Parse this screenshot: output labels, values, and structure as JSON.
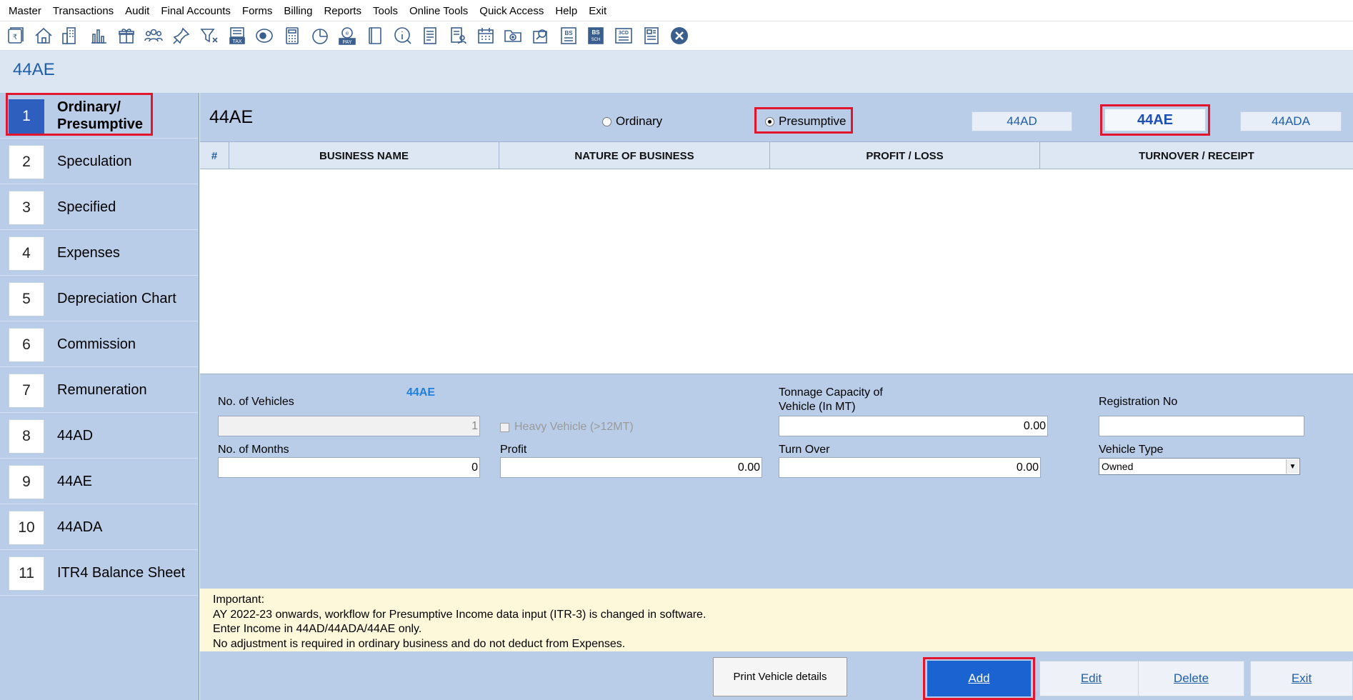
{
  "menu": [
    "Master",
    "Transactions",
    "Audit",
    "Final Accounts",
    "Forms",
    "Billing",
    "Reports",
    "Tools",
    "Online Tools",
    "Quick Access",
    "Help",
    "Exit"
  ],
  "toolbar_icons": [
    "rupee-book-icon",
    "home-icon",
    "building-icon",
    "bar-chart-icon",
    "gift-icon",
    "people-icon",
    "pin-icon",
    "filter-icon",
    "tax-icon",
    "eye-icon",
    "calculator-icon",
    "pie-icon",
    "epay-icon",
    "book-icon",
    "info-icon",
    "document-icon",
    "user-document-icon",
    "calendar-icon",
    "folder-add-icon",
    "search-folder-icon",
    "bs-icon",
    "bs-sch-icon",
    "3cd-icon",
    "report-icon",
    "close-circle-icon"
  ],
  "toolbar_badges": {
    "tax": "TAX",
    "epay": "PAY",
    "bs": "BS",
    "bssch": "SCH",
    "cd3": "3CD"
  },
  "page_title": "44AE",
  "nav": [
    {
      "num": "1",
      "label": "Ordinary/ Presumptive"
    },
    {
      "num": "2",
      "label": "Speculation"
    },
    {
      "num": "3",
      "label": "Specified"
    },
    {
      "num": "4",
      "label": "Expenses"
    },
    {
      "num": "5",
      "label": "Depreciation Chart"
    },
    {
      "num": "6",
      "label": "Commission"
    },
    {
      "num": "7",
      "label": "Remuneration"
    },
    {
      "num": "8",
      "label": "44AD"
    },
    {
      "num": "9",
      "label": "44AE"
    },
    {
      "num": "10",
      "label": "44ADA"
    },
    {
      "num": "11",
      "label": "ITR4 Balance Sheet"
    }
  ],
  "main": {
    "section_title": "44AE",
    "radio_ordinary": "Ordinary",
    "radio_presumptive": "Presumptive",
    "selected_mode": "Presumptive",
    "btn_44ad": "44AD",
    "btn_44ae": "44AE",
    "btn_44ada": "44ADA"
  },
  "table": {
    "columns": [
      "#",
      "BUSINESS NAME",
      "NATURE OF BUSINESS",
      "PROFIT / LOSS",
      "TURNOVER / RECEIPT"
    ],
    "rows": []
  },
  "form": {
    "tag": "44AE",
    "no_vehicles_label": "No. of Vehicles",
    "no_vehicles_value": "1",
    "heavy_vehicle_label": "Heavy Vehicle (>12MT)",
    "tonnage_label_1": "Tonnage Capacity of",
    "tonnage_label_2": "Vehicle (In MT)",
    "tonnage_value": "0.00",
    "registration_label": "Registration No",
    "registration_value": "",
    "no_months_label": "No. of Months",
    "no_months_value": "0",
    "profit_label": "Profit",
    "profit_value": "0.00",
    "turnover_label": "Turn Over",
    "turnover_value": "0.00",
    "vehicle_type_label": "Vehicle Type",
    "vehicle_type_value": "Owned"
  },
  "notice": {
    "line1": "Important:",
    "line2": "AY 2022-23 onwards, workflow for Presumptive Income data input (ITR-3) is changed in software.",
    "line3": "Enter Income in 44AD/44ADA/44AE only.",
    "line4": "No adjustment is required in ordinary business and do not deduct from Expenses."
  },
  "buttons": {
    "print": "Print  Vehicle details",
    "add": "Add",
    "edit": "Edit",
    "delete": "Delete",
    "exit": "Exit"
  },
  "colors": {
    "highlight": "#e2152c",
    "accent": "#1c63d2",
    "panel": "#b9cde8"
  }
}
